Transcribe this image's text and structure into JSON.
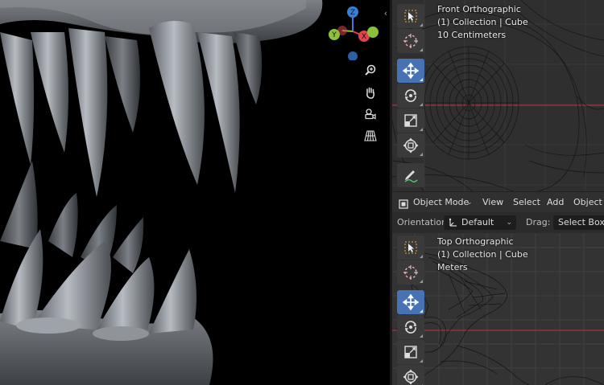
{
  "left_viewport": {
    "gizmo": {
      "z_label": "Z",
      "x_label": "X",
      "y_label": "Y"
    },
    "nav_icons": [
      "zoom-icon",
      "hand-pan-icon",
      "camera-icon",
      "grid-perspective-icon"
    ],
    "collapse_glyph": "‹"
  },
  "front_viewport": {
    "title": "Front Orthographic",
    "collection": "(1) Collection | Cube",
    "scale": "10 Centimeters"
  },
  "top_viewport": {
    "title": "Top Orthographic",
    "collection": "(1) Collection | Cube",
    "scale": "Meters"
  },
  "toolbar": {
    "tools": [
      "select-box",
      "cursor",
      "move",
      "rotate",
      "scale",
      "transform",
      "annotate"
    ],
    "active": "move"
  },
  "header": {
    "mode": "Object Mode",
    "menu": [
      "View",
      "Select",
      "Add",
      "Object"
    ],
    "orientation_label": "Orientation:",
    "orientation_value": "Default",
    "drag_label": "Drag:",
    "drag_value": "Select Box"
  },
  "colors": {
    "active_tool": "#4772b3",
    "axis_x": "#e0424f",
    "axis_y": "#8bc13a",
    "axis_z": "#3a7fd6",
    "x_line": "#a8313b"
  }
}
